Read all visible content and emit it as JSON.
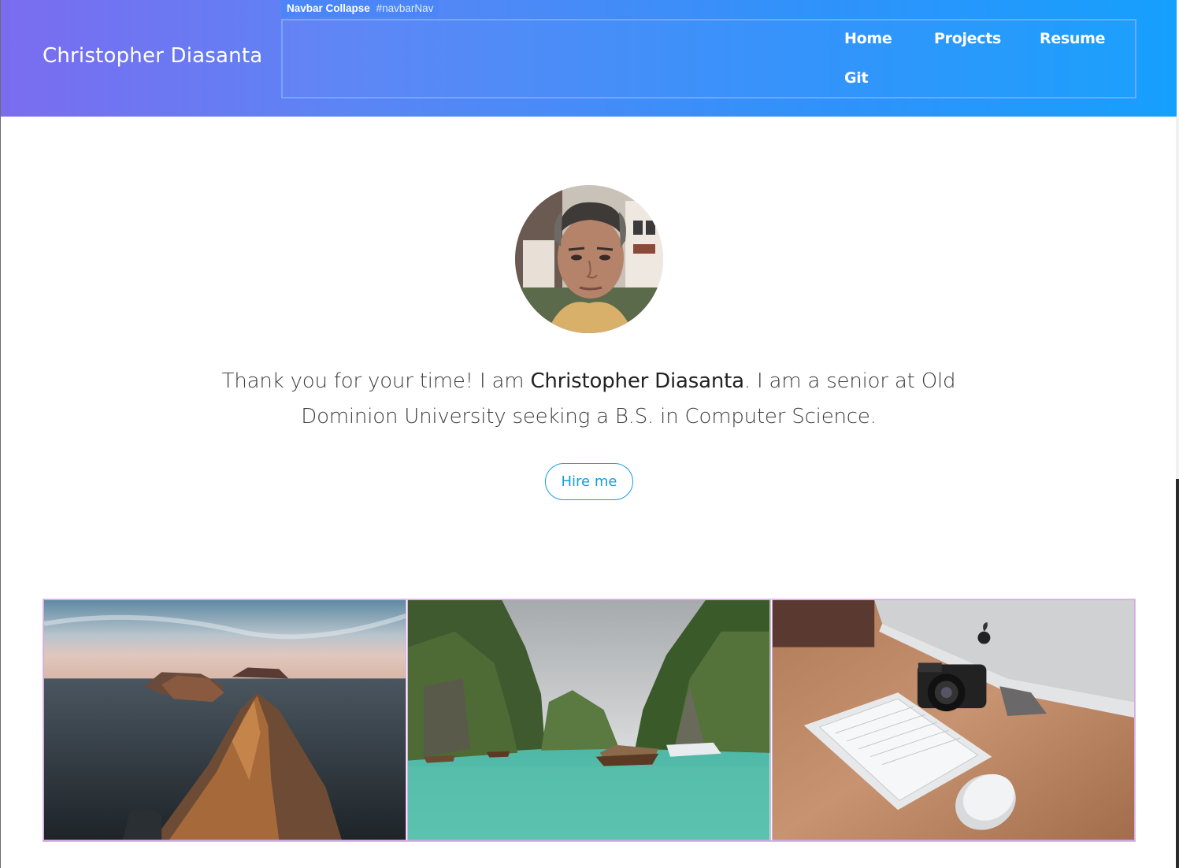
{
  "header": {
    "brand": "Christopher Diasanta",
    "inspector": {
      "name": "Navbar Collapse",
      "selector": "#navbarNav"
    },
    "nav": [
      {
        "label": "Home"
      },
      {
        "label": "Projects"
      },
      {
        "label": "Resume"
      },
      {
        "label": "Git"
      }
    ]
  },
  "intro": {
    "text_before": "Thank you for your time! I am ",
    "name": "Christopher Diasanta",
    "text_after": ". I am a senior at Old Dominion University seeking a B.S. in Computer Science.",
    "button_label": "Hire me"
  },
  "gallery": {
    "photos": [
      {
        "icon": "coastal-cliffs-photo"
      },
      {
        "icon": "lagoon-boats-photo"
      },
      {
        "icon": "desk-camera-keyboard-photo"
      }
    ]
  },
  "colors": {
    "accent": "#1a9be0",
    "header_gradient_start": "#7b6cf0",
    "header_gradient_end": "#16a0fd"
  }
}
